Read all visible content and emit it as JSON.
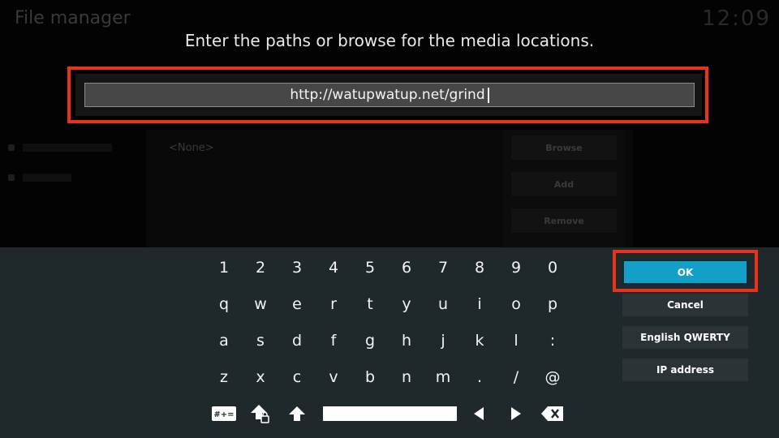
{
  "background": {
    "title": "File manager",
    "clock": "12:09",
    "none_label": "<None>",
    "browse_label": "Browse",
    "add_label": "Add",
    "remove_label": "Remove"
  },
  "dialog": {
    "heading": "Enter the paths or browse for the media locations.",
    "input_value": "http://watupwatup.net/grind"
  },
  "keyboard": {
    "rows": [
      [
        "1",
        "2",
        "3",
        "4",
        "5",
        "6",
        "7",
        "8",
        "9",
        "0"
      ],
      [
        "q",
        "w",
        "e",
        "r",
        "t",
        "y",
        "u",
        "i",
        "o",
        "p"
      ],
      [
        "a",
        "s",
        "d",
        "f",
        "g",
        "h",
        "j",
        "k",
        "l",
        ":"
      ],
      [
        "z",
        "x",
        "c",
        "v",
        "b",
        "n",
        "m",
        ".",
        "/",
        "@"
      ]
    ],
    "symbols_label": "#+=",
    "icons": [
      "shift-lock-icon",
      "shift-icon",
      "space-bar",
      "arrow-left-icon",
      "arrow-right-icon",
      "backspace-icon"
    ]
  },
  "buttons": {
    "ok": "OK",
    "cancel": "Cancel",
    "layout": "English QWERTY",
    "ip": "IP address"
  },
  "colors": {
    "highlight": "#e8331c",
    "ok_accent": "#12a0c8",
    "keyboard_bg": "#1f282b"
  }
}
